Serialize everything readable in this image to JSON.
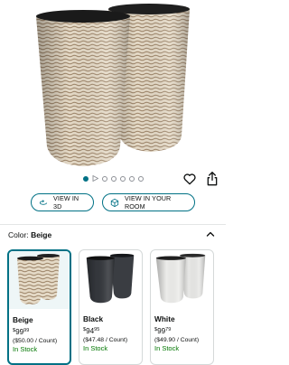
{
  "gallery": {
    "dot_count": 7,
    "active_index": 0,
    "video_index": 1
  },
  "actions": {
    "view_3d_label": "VIEW IN 3D",
    "view_room_label": "VIEW IN YOUR ROOM"
  },
  "variation": {
    "label": "Color:",
    "selected": "Beige"
  },
  "options": [
    {
      "name": "Beige",
      "price_currency": "$",
      "price_whole": "99",
      "price_cents": "99",
      "unit_price": "($50.00 / Count)",
      "availability": "In Stock",
      "selected": true,
      "color": "#d8ccb8"
    },
    {
      "name": "Black",
      "price_currency": "$",
      "price_whole": "94",
      "price_cents": "95",
      "unit_price": "($47.48 / Count)",
      "availability": "In Stock",
      "selected": false,
      "color": "#3a3d42"
    },
    {
      "name": "White",
      "price_currency": "$",
      "price_whole": "99",
      "price_cents": "79",
      "unit_price": "($49.90 / Count)",
      "availability": "In Stock",
      "selected": false,
      "color": "#e6e6e4"
    }
  ],
  "colors": {
    "accent": "#007185",
    "in_stock": "#007600"
  }
}
